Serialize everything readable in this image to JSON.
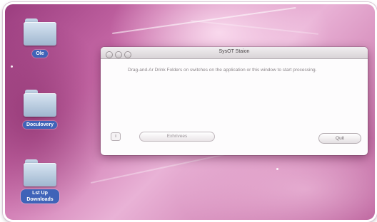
{
  "desktop": {
    "icons": [
      {
        "label": "Ole",
        "icon": "folder-icon"
      },
      {
        "label": "Doculovery",
        "icon": "folder-icon"
      },
      {
        "label": "Lst Up Downloads",
        "icon": "folder-icon"
      }
    ]
  },
  "window": {
    "title": "SysOT Staion",
    "instructions": "Drag-and-Ar Drink Folders on switches on the application or this window to start processing.",
    "info_button_label": "i",
    "popup_label": "Exhrivees",
    "quit_label": "Quit"
  },
  "colors": {
    "desktop_accent": "#c86aa8",
    "label_blue": "#3f63b8"
  }
}
